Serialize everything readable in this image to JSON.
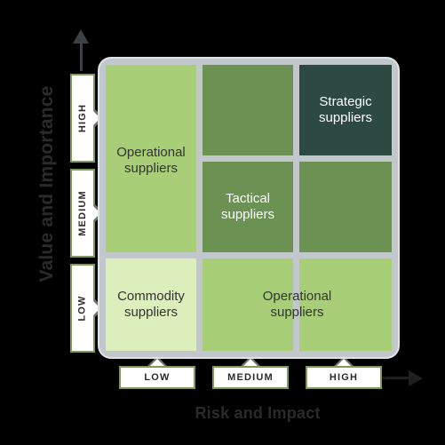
{
  "chart_data": {
    "type": "heatmap",
    "title": "",
    "xlabel": "Risk and Impact",
    "ylabel": "Value and Importance",
    "x_categories": [
      "LOW",
      "MEDIUM",
      "HIGH"
    ],
    "y_categories": [
      "HIGH",
      "MEDIUM",
      "LOW"
    ],
    "grid": true,
    "legend": "none",
    "cells": [
      {
        "row": "HIGH",
        "col": "LOW",
        "label": "Operational suppliers",
        "color": "#a8ce78",
        "text_color": "#333333"
      },
      {
        "row": "HIGH",
        "col": "MEDIUM",
        "label": "",
        "color": "#6b9153",
        "text_color": "#ffffff"
      },
      {
        "row": "HIGH",
        "col": "HIGH",
        "label": "Strategic suppliers",
        "color": "#2c4942",
        "text_color": "#ffffff"
      },
      {
        "row": "MEDIUM",
        "col": "LOW",
        "label": "",
        "color": "#a8ce78",
        "text_color": "#333333"
      },
      {
        "row": "MEDIUM",
        "col": "MEDIUM",
        "label": "Tactical suppliers",
        "color": "#6b9153",
        "text_color": "#ffffff"
      },
      {
        "row": "MEDIUM",
        "col": "HIGH",
        "label": "",
        "color": "#6b9153",
        "text_color": "#ffffff"
      },
      {
        "row": "LOW",
        "col": "LOW",
        "label": "Commodity suppliers",
        "color": "#dbeebb",
        "text_color": "#333333"
      },
      {
        "row": "LOW",
        "col": "MEDIUM",
        "label": "Operational suppliers",
        "color": "#a8ce78",
        "text_color": "#333333"
      },
      {
        "row": "LOW",
        "col": "HIGH",
        "label": "",
        "color": "#a8ce78",
        "text_color": "#333333"
      }
    ]
  },
  "axes": {
    "y": {
      "title": "Value and Importance",
      "arrow": "up-arrow-icon",
      "ticks": [
        {
          "label": "HIGH"
        },
        {
          "label": "MEDIUM"
        },
        {
          "label": "LOW"
        }
      ]
    },
    "x": {
      "title": "Risk and Impact",
      "arrow": "right-arrow-icon",
      "ticks": [
        {
          "label": "LOW"
        },
        {
          "label": "MEDIUM"
        },
        {
          "label": "HIGH"
        }
      ]
    }
  },
  "matrix": {
    "quadrant_labels": {
      "operational_top": "Operational\nsuppliers",
      "operational_top_line1": "Operational",
      "operational_top_line2": "suppliers",
      "strategic_line1": "Strategic",
      "strategic_line2": "suppliers",
      "tactical_line1": "Tactical",
      "tactical_line2": "suppliers",
      "commodity_line1": "Commodity",
      "commodity_line2": "suppliers",
      "operational_bottom_line1": "Operational",
      "operational_bottom_line2": "suppliers"
    }
  },
  "colors": {
    "background": "#000000",
    "frame": "#c2c7cc",
    "frame_outline": "#dfe3e6",
    "cell_light": "#dbeebb",
    "cell_mid": "#a8ce78",
    "cell_dark": "#6b9153",
    "cell_darkest": "#2c4942",
    "banner_border": "#7d9c5a",
    "banner_fill": "#ffffff",
    "text_dark": "#2a2a2a",
    "arrow": "#3b4145"
  }
}
